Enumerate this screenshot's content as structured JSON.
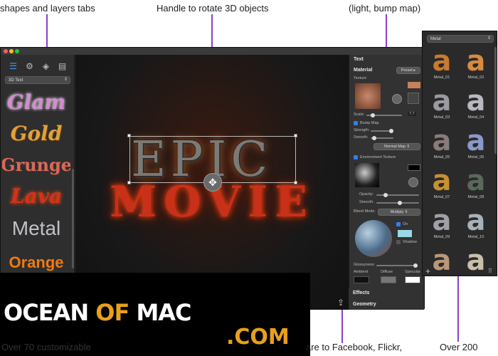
{
  "annotations": {
    "top_left": "shapes and layers tabs",
    "top_center": "Handle to rotate 3D objects",
    "top_right": "(light, bump map)",
    "bottom_left": "Over 70 customizable",
    "bottom_center": "are to Facebook, Flickr,",
    "bottom_right": "Over 200"
  },
  "left_panel": {
    "dropdown": "3D Text",
    "presets": [
      "Glam",
      "Gold",
      "Grunge",
      "Lava",
      "Metal",
      "Orange"
    ]
  },
  "canvas": {
    "line1": "EPIC",
    "line2": "MOVIE"
  },
  "inspector": {
    "section_title": "Text",
    "material_label": "Material",
    "preset_button": "Preset",
    "texture_label": "Texture",
    "scale_label": "Scale:",
    "scale_value": "7.7",
    "bump_map_label": "Bump Map",
    "strength_label": "Strength:",
    "smooth_label": "Smooth:",
    "normal_map_select": "Normal Map",
    "env_texture_label": "Environment Texture",
    "opacity_label": "Opacity:",
    "smooth2_label": "Smooth:",
    "blend_mode_label": "Blend Mode:",
    "blend_mode_value": "Multiply",
    "on_label": "On",
    "shadow_label": "Shadow",
    "glossyness_label": "Glossyness:",
    "ambient_label": "Ambient",
    "diffuse_label": "Diffuse",
    "specular_label": "Specular",
    "effects_label": "Effects",
    "geometry_label": "Geometry"
  },
  "library": {
    "dropdown": "Metal",
    "tiles": [
      "Metal_01",
      "Metal_02",
      "Metal_03",
      "Metal_04",
      "Metal_05",
      "Metal_06",
      "Metal_07",
      "Metal_08",
      "Metal_09",
      "Metal_10"
    ]
  },
  "watermark": {
    "ocean": "OCEAN ",
    "of": "OF",
    "mac": " MAC",
    "com": ".COM"
  },
  "colors": {
    "accent": "#3ea0ff",
    "annotation_line": "#8a3fc9",
    "watermark_orange": "#e8a01c"
  }
}
